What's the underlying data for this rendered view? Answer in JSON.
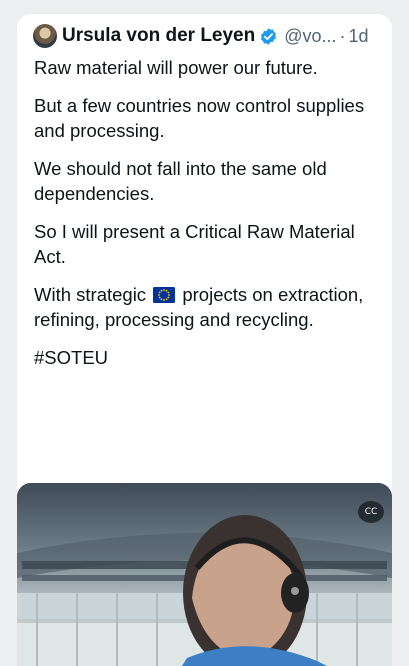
{
  "tweet": {
    "author_name": "Ursula von der Leyen",
    "handle": "@vo...",
    "separator": "·",
    "time": "1d",
    "verified_icon": "verified-badge-icon",
    "lines": {
      "l1": "Raw material will power our future.",
      "l2": "But a few countries now control supplies and processing.",
      "l3": "We should not fall into the same old dependencies.",
      "l4": "So I will present a Critical Raw Material Act.",
      "l5_before": "With strategic",
      "l5_after": "projects on extraction, refining, processing and recycling.",
      "l6": "#SOTEU"
    },
    "flag_icon": "eu-flag-icon"
  },
  "media": {
    "captions_label": "CC",
    "captions_icon": "closed-captions-icon"
  },
  "colors": {
    "text": "#0f1419",
    "muted": "#536471",
    "verified": "#1d9bf0",
    "eu_blue": "#003399",
    "eu_gold": "#ffcc00"
  }
}
